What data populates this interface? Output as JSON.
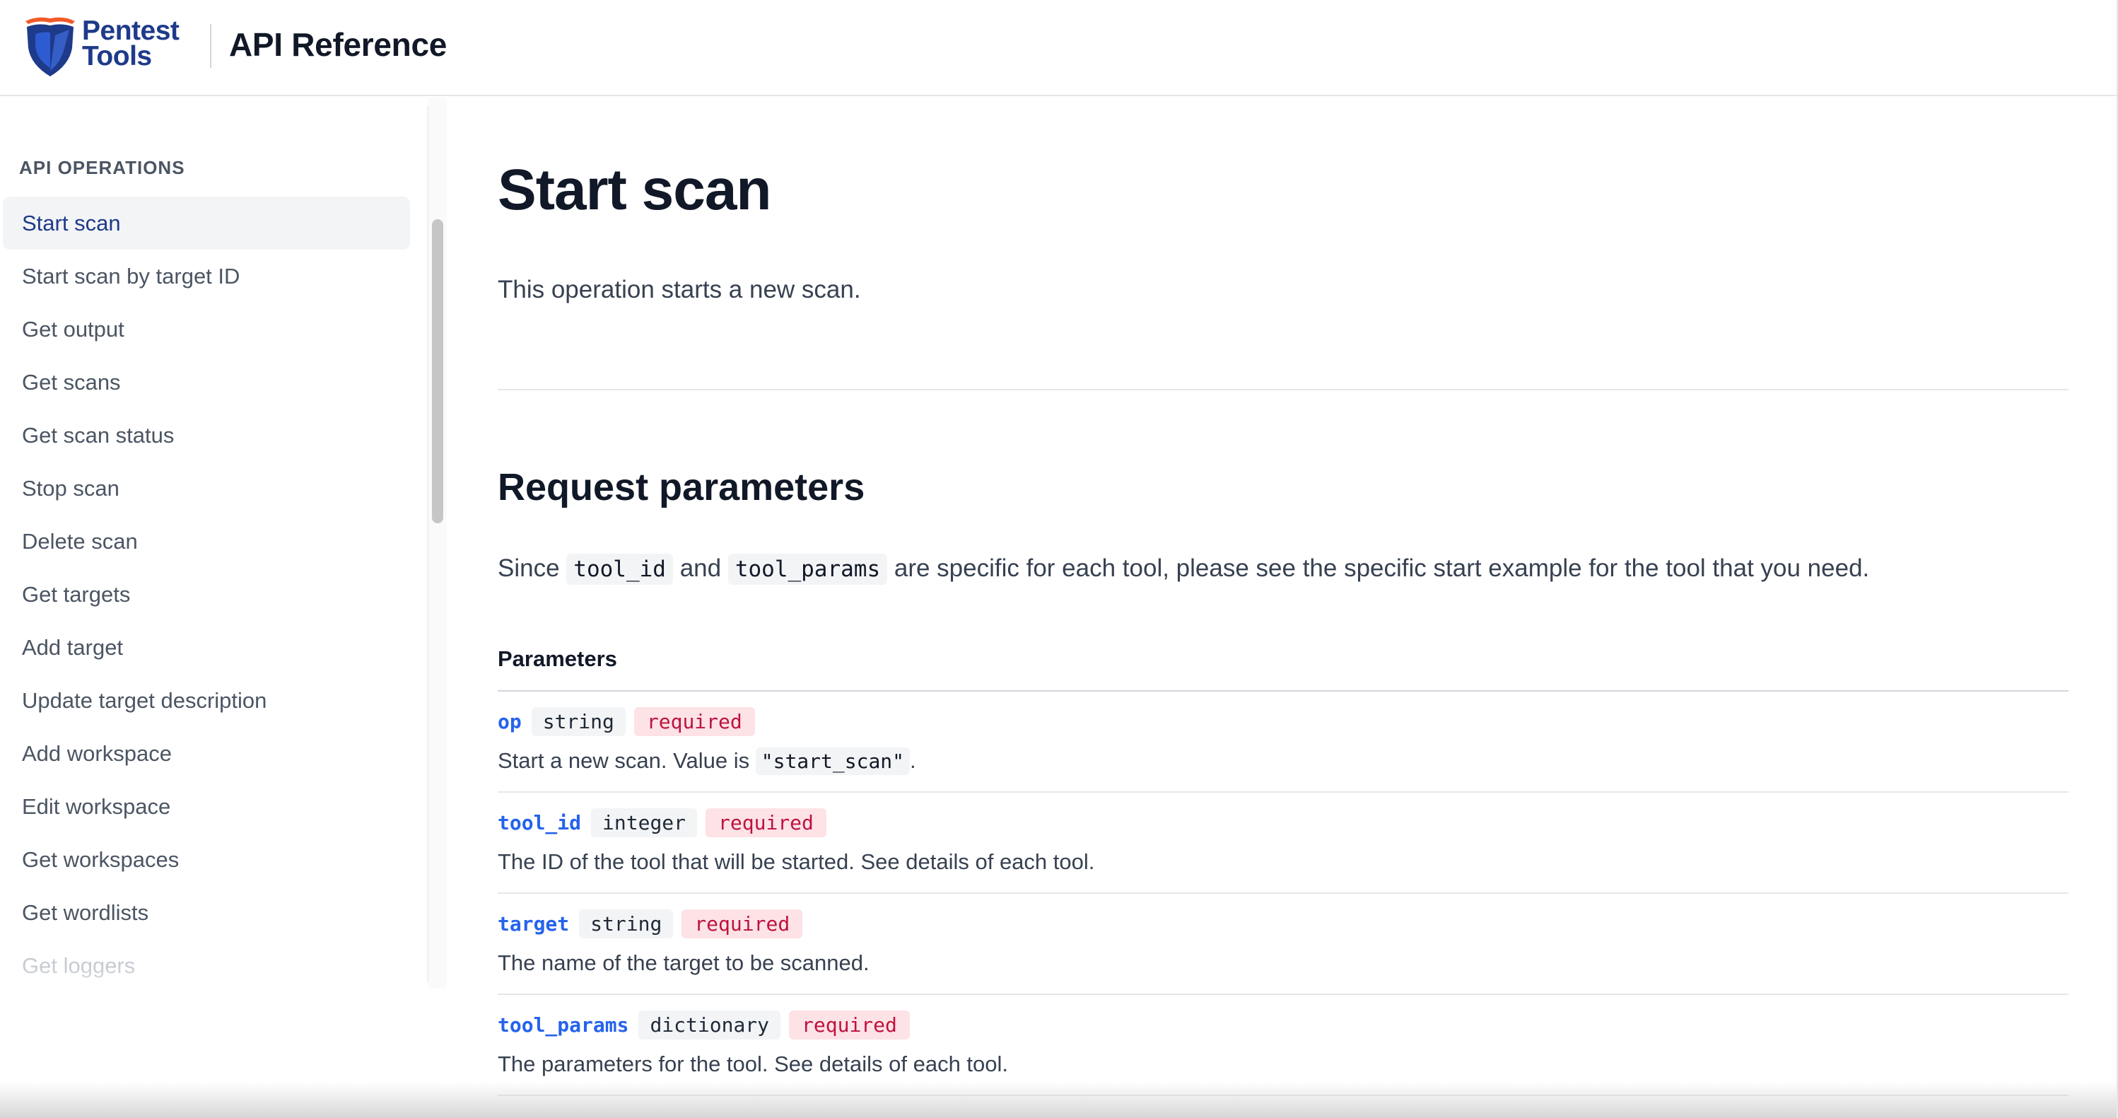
{
  "header": {
    "logo_line1": "Pentest",
    "logo_line2": "Tools",
    "title": "API Reference"
  },
  "sidebar": {
    "heading": "API OPERATIONS",
    "items": [
      {
        "label": "Start scan"
      },
      {
        "label": "Start scan by target ID"
      },
      {
        "label": "Get output"
      },
      {
        "label": "Get scans"
      },
      {
        "label": "Get scan status"
      },
      {
        "label": "Stop scan"
      },
      {
        "label": "Delete scan"
      },
      {
        "label": "Get targets"
      },
      {
        "label": "Add target"
      },
      {
        "label": "Update target description"
      },
      {
        "label": "Add workspace"
      },
      {
        "label": "Edit workspace"
      },
      {
        "label": "Get workspaces"
      },
      {
        "label": "Get wordlists"
      },
      {
        "label": "Get loggers"
      }
    ],
    "active_item": "Start scan"
  },
  "main": {
    "title": "Start scan",
    "lead": "This operation starts a new scan.",
    "section_title": "Request parameters",
    "intro": {
      "before": "Since",
      "code1": "tool_id",
      "middle": "and",
      "code2": "tool_params",
      "after": "are specific for each tool, please see the specific start example for the tool that you need."
    },
    "params_label": "Parameters",
    "params": [
      {
        "name": "op",
        "type": "string",
        "required": "required",
        "desc_before": "Start a new scan. Value is",
        "desc_code": "\"start_scan\"",
        "desc_after": "."
      },
      {
        "name": "tool_id",
        "type": "integer",
        "required": "required",
        "desc_before": "The ID of the tool that will be started. See details of each tool.",
        "desc_code": "",
        "desc_after": ""
      },
      {
        "name": "target",
        "type": "string",
        "required": "required",
        "desc_before": "The name of the target to be scanned.",
        "desc_code": "",
        "desc_after": ""
      },
      {
        "name": "tool_params",
        "type": "dictionary",
        "required": "required",
        "desc_before": "The parameters for the tool. See details of each tool.",
        "desc_code": "",
        "desc_after": ""
      }
    ]
  },
  "colors": {
    "brand_blue": "#1e3a8a",
    "param_blue": "#2563eb",
    "required_red": "#be123c",
    "logo_orange": "#f05a28"
  }
}
